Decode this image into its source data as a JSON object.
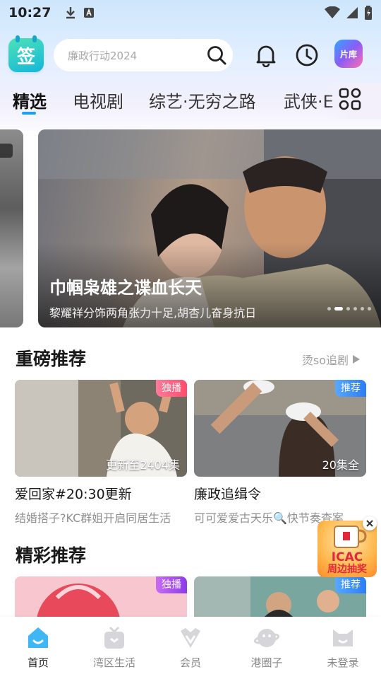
{
  "status_bar": {
    "time": "10:27"
  },
  "header": {
    "sign_label": "签",
    "search_placeholder": "廉政行动2024",
    "library_label": "片库"
  },
  "tabs": [
    {
      "label": "精选",
      "active": true
    },
    {
      "label": "电视剧"
    },
    {
      "label": "综艺·无穷之路"
    },
    {
      "label": "武侠·E"
    }
  ],
  "banner": {
    "title": "巾帼枭雄之谍血长天",
    "subtitle": "黎耀祥分饰两角张力十足,胡杏儿奋身抗日",
    "dot_count": 6,
    "active_dot": 1
  },
  "section_heavy": {
    "title": "重磅推荐",
    "more_label": "烫so追剧",
    "cards": [
      {
        "badge": "独播",
        "episode": "更新至2404集",
        "title": "爱回家#20:30更新",
        "desc": "结婚搭子?KC群姐开启同居生活"
      },
      {
        "badge": "推荐",
        "episode": "20集全",
        "title": "廉政追缉令",
        "desc": "可可爱爱古天乐🔍快节奏查案"
      }
    ]
  },
  "section_featured": {
    "title": "精彩推荐",
    "cards": [
      {
        "badge": "独播"
      },
      {
        "badge": "推荐"
      }
    ]
  },
  "float_ad": {
    "line1": "ICAC",
    "line2": "周边抽奖"
  },
  "bottom_nav": [
    {
      "label": "首页",
      "active": true
    },
    {
      "label": "湾区生活"
    },
    {
      "label": "会员"
    },
    {
      "label": "港圈子"
    },
    {
      "label": "未登录"
    }
  ],
  "colors": {
    "accent": "#1aa2f0",
    "badge_exclusive": "#ff4d6d",
    "badge_recommend": "#2d7df6"
  }
}
